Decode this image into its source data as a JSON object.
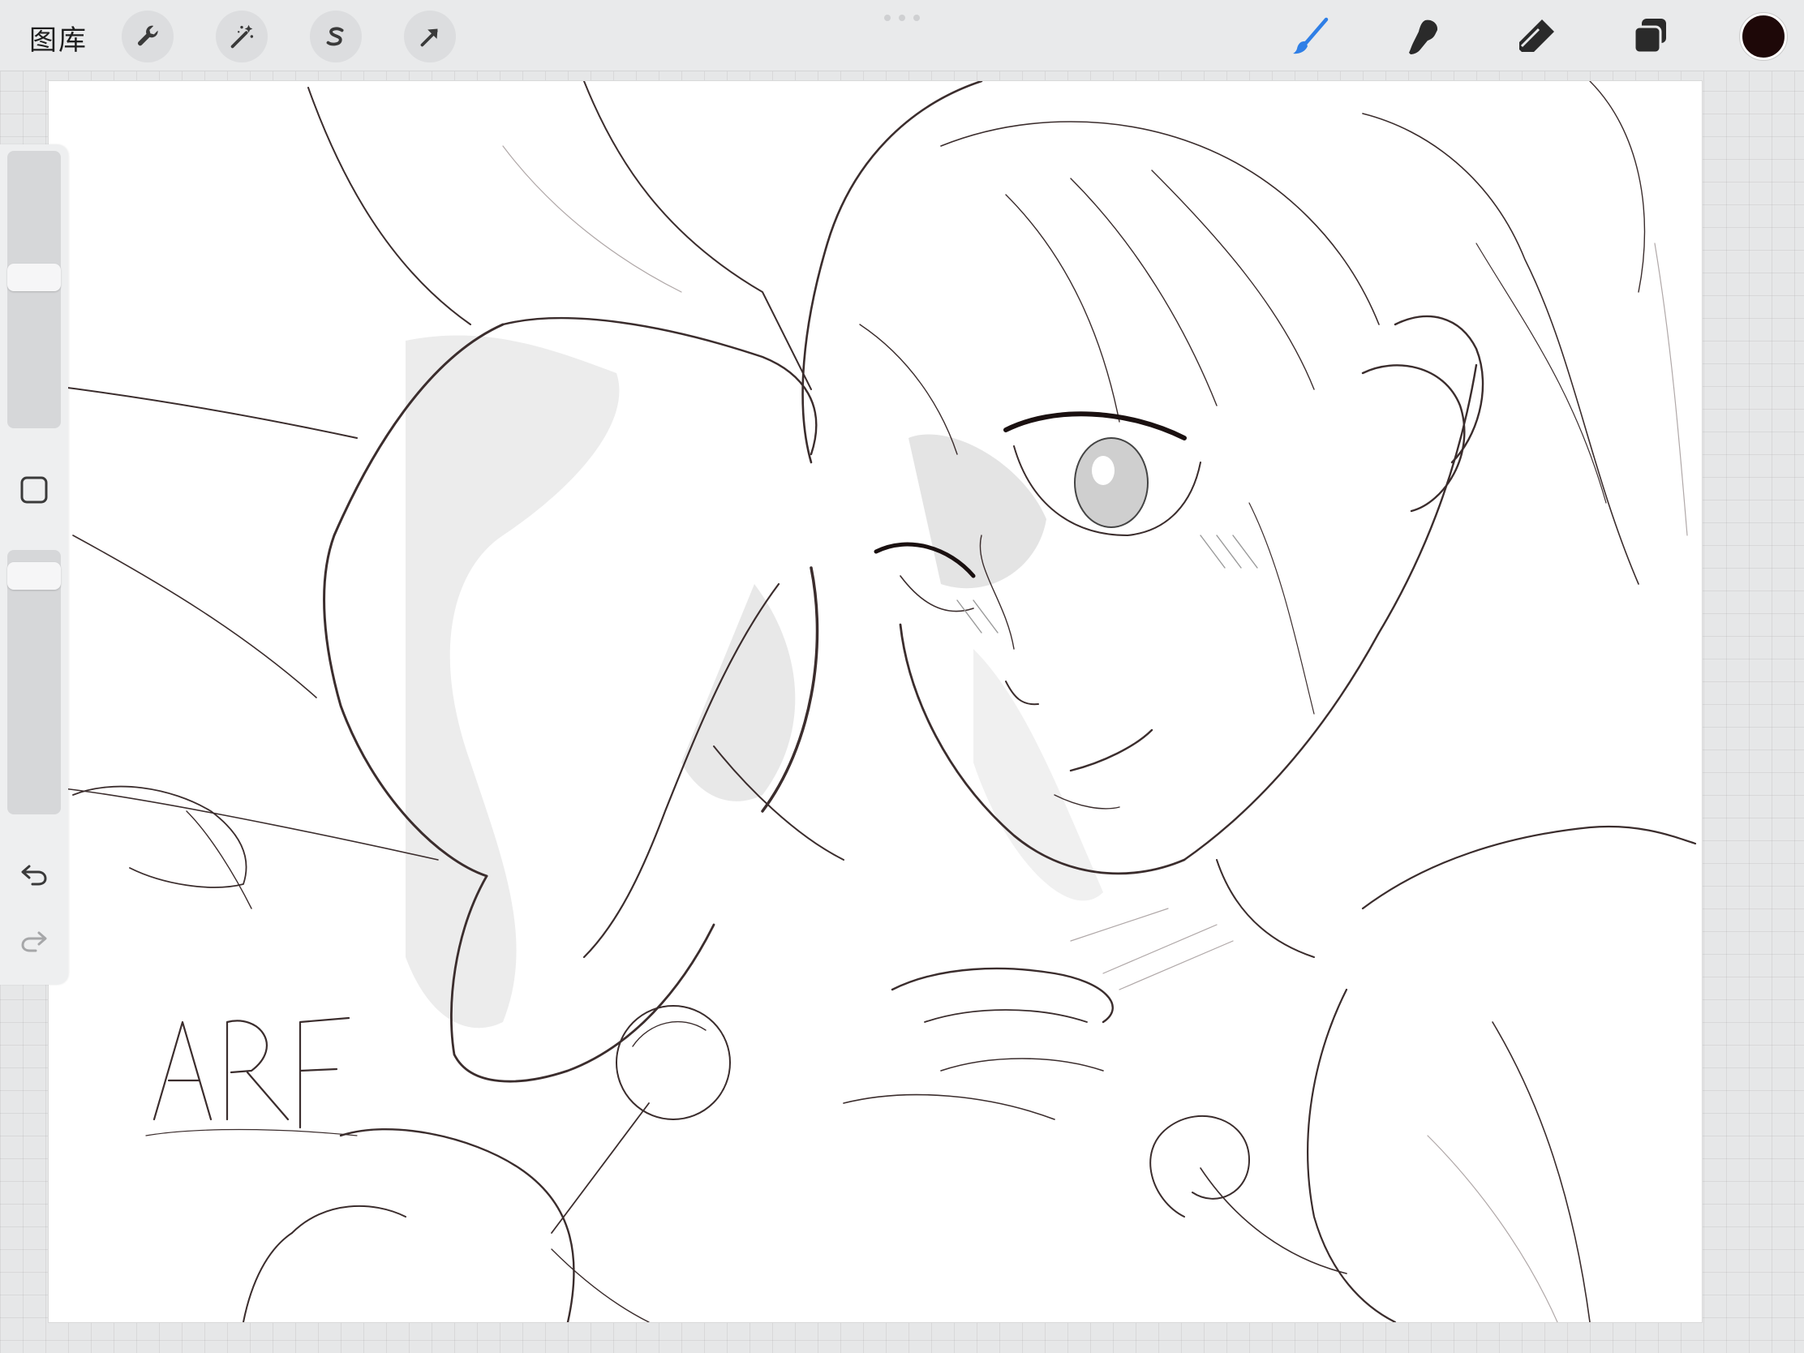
{
  "toolbar": {
    "gallery_label": "图库",
    "tools": [
      {
        "name": "actions-wrench",
        "icon": "wrench-icon"
      },
      {
        "name": "adjustments-magic-wand",
        "icon": "magic-wand-icon"
      },
      {
        "name": "selection",
        "icon": "selection-s-icon"
      },
      {
        "name": "transform",
        "icon": "arrow-cursor-icon"
      }
    ],
    "right_tools": [
      {
        "name": "brush",
        "icon": "brush-icon",
        "active": true
      },
      {
        "name": "smudge",
        "icon": "smudge-finger-icon",
        "active": false
      },
      {
        "name": "eraser",
        "icon": "eraser-icon",
        "active": false
      },
      {
        "name": "layers",
        "icon": "layers-icon",
        "active": false
      }
    ],
    "current_color": "#1e0808",
    "accent_color": "#2f7fe6"
  },
  "sidebar": {
    "brush_size_level": 0.55,
    "opacity_level": 0.95,
    "icons": [
      "modify-square-icon",
      "undo-icon",
      "redo-icon"
    ]
  }
}
